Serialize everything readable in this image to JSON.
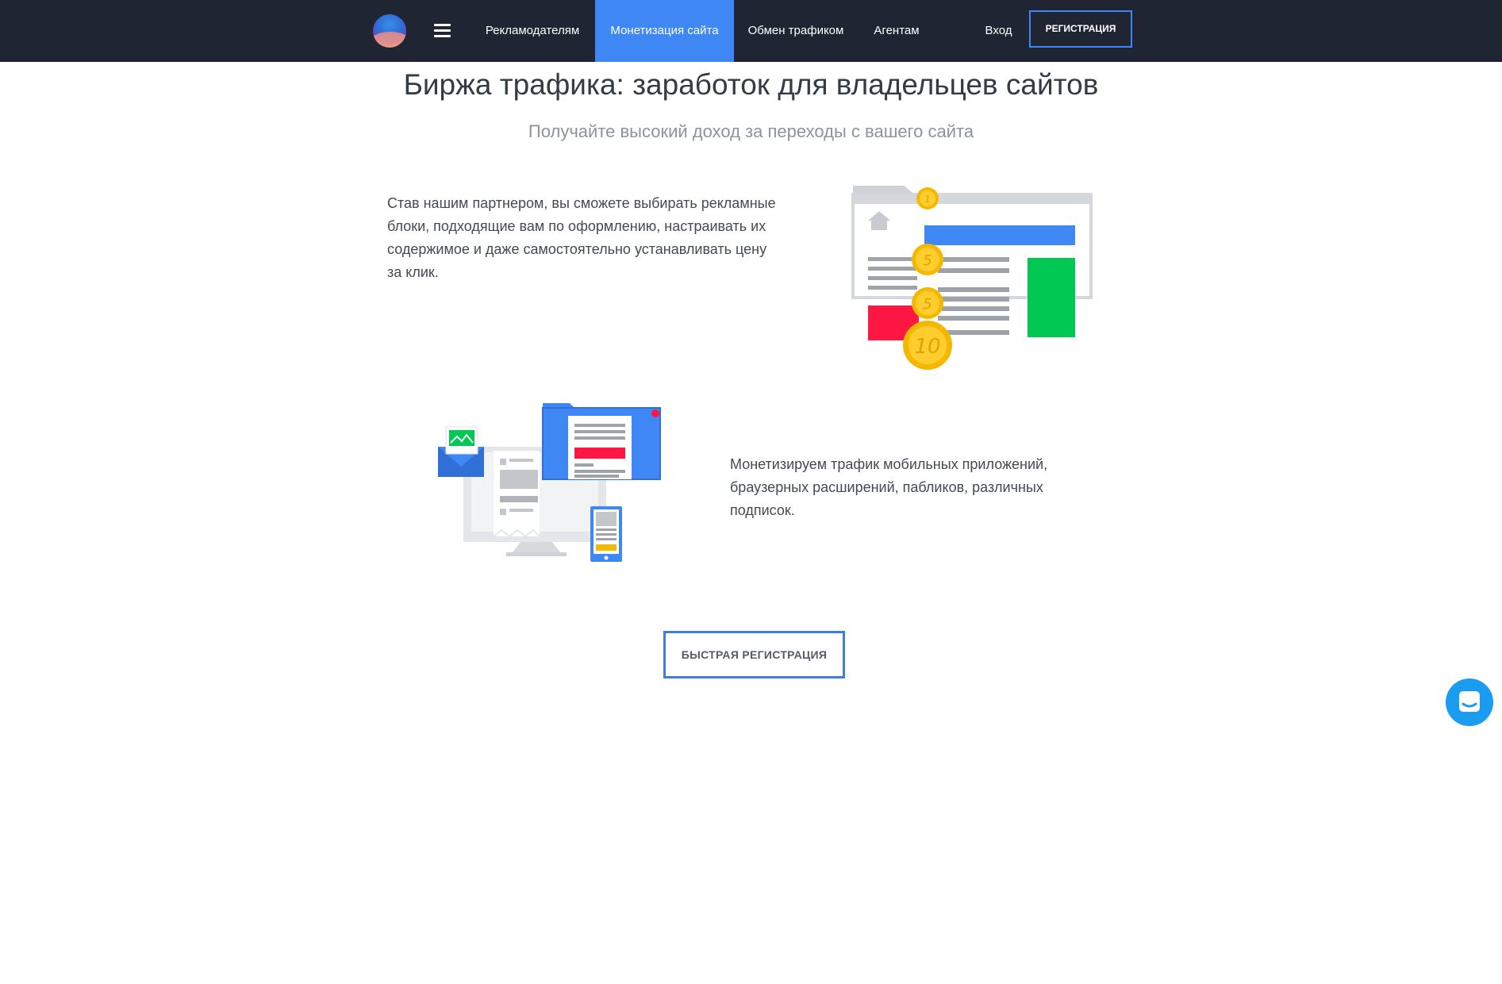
{
  "header": {
    "nav": [
      {
        "label": "Рекламодателям"
      },
      {
        "label": "Монетизация сайта",
        "active": true
      },
      {
        "label": "Обмен трафиком"
      },
      {
        "label": "Агентам"
      }
    ],
    "login_label": "Вход",
    "register_label": "Регистрация"
  },
  "main": {
    "title": "Биржа трафика: заработок для владельцев сайтов",
    "subtitle": "Получайте высокий доход за переходы с вашего сайта",
    "feature1_text": "Став нашим партнером, вы сможете выбирать рекламные блоки, подходящие вам по оформлению, настраивать их содержимое и даже самостоятельно устанавливать цену за клик.",
    "feature2_text": "Монетизируем трафик мобильных приложений, браузерных расширений, пабликов, различных подписок.",
    "coins": [
      "1",
      "5",
      "5",
      "10"
    ],
    "cta_label": "Быстрая регистрация"
  },
  "colors": {
    "header_bg": "#1f2533",
    "accent": "#3f87f5",
    "coin": "#f5b800",
    "green": "#00c853",
    "red": "#ff1744"
  }
}
